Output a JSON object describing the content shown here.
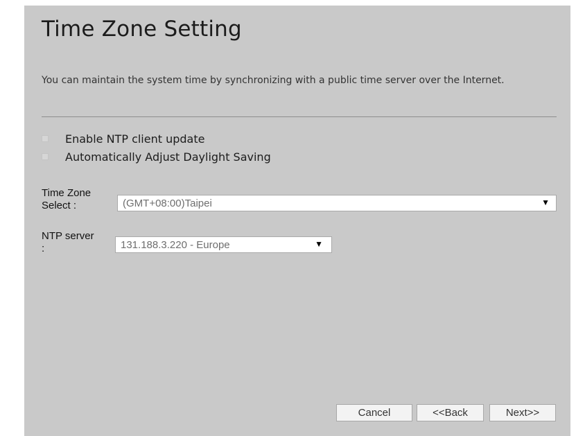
{
  "page": {
    "title": "Time Zone Setting",
    "description": "You can maintain the system time by synchronizing with a public time server over the Internet."
  },
  "options": {
    "ntp_client": {
      "label": "Enable NTP client update",
      "checked": false
    },
    "daylight_saving": {
      "label": "Automatically Adjust Daylight Saving",
      "checked": false
    }
  },
  "timezone": {
    "label_line1": "Time Zone",
    "label_line2": "Select :",
    "value": "(GMT+08:00)Taipei"
  },
  "ntp_server": {
    "label_line1": "NTP server",
    "label_line2": ":",
    "value": "131.188.3.220 - Europe"
  },
  "buttons": {
    "cancel": "Cancel",
    "back": "<<Back",
    "next": "Next>>"
  },
  "icons": {
    "dropdown_arrow": "▼"
  },
  "colors": {
    "panel_bg": "#c9c9c9",
    "page_bg": "#ffffff"
  }
}
